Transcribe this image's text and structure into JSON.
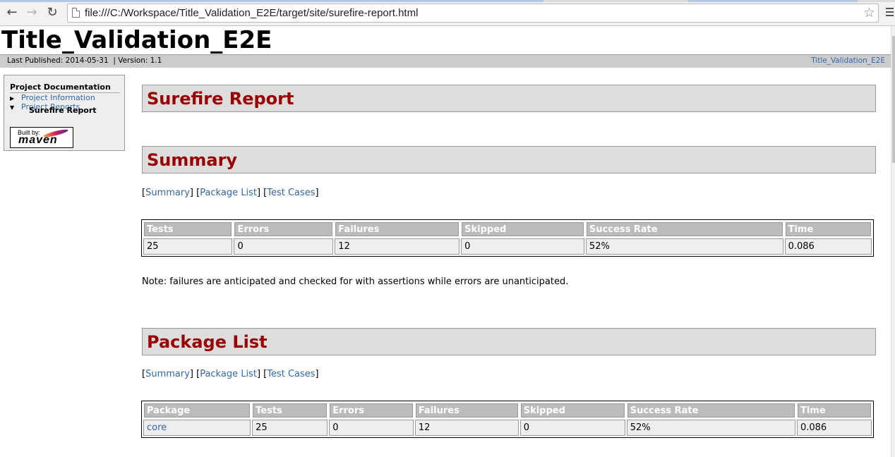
{
  "browser": {
    "url": "file:///C:/Workspace/Title_Validation_E2E/target/site/surefire-report.html"
  },
  "site": {
    "title": "Title_Validation_E2E",
    "last_published": "Last Published: 2014-05-31",
    "version": "| Version: 1.1",
    "breadcrumb_link": "Title_Validation_E2E"
  },
  "nav": {
    "heading": "Project Documentation",
    "items": [
      {
        "label": "Project Information",
        "expanded": false
      },
      {
        "label": "Project Reports",
        "expanded": true
      }
    ],
    "current": "Surefire Report",
    "badge_top": "Built by:",
    "badge_bottom": "maven"
  },
  "report": {
    "title": "Surefire Report",
    "summary_heading": "Summary",
    "package_heading": "Package List",
    "links": {
      "summary": "Summary",
      "package_list": "Package List",
      "test_cases": "Test Cases"
    },
    "summary_table": {
      "headers": [
        "Tests",
        "Errors",
        "Failures",
        "Skipped",
        "Success Rate",
        "Time"
      ],
      "row": [
        "25",
        "0",
        "12",
        "0",
        "52%",
        "0.086"
      ]
    },
    "note": "Note: failures are anticipated and checked for with assertions while errors are unanticipated.",
    "package_table": {
      "headers": [
        "Package",
        "Tests",
        "Errors",
        "Failures",
        "Skipped",
        "Success Rate",
        "Time"
      ],
      "row": [
        "core",
        "25",
        "0",
        "12",
        "0",
        "52%",
        "0.086"
      ]
    }
  },
  "colors": {
    "heading_red": "#990000",
    "link_blue": "#3366aa",
    "table_header": "#bbbbbb",
    "cell_bg": "#eeeeee"
  }
}
